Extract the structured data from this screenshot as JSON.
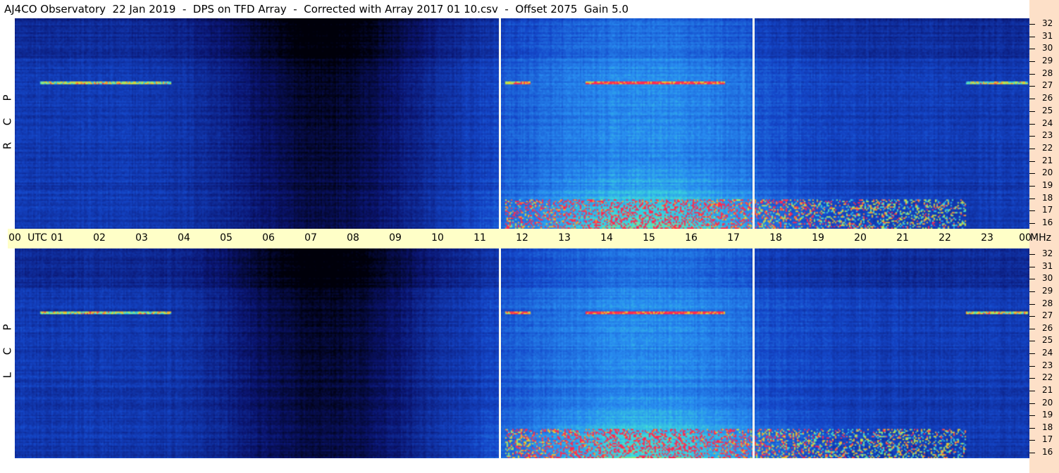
{
  "title": "AJ4CO Observatory  22 Jan 2019  -  DPS on TFD Array  -  Corrected with Array 2017 01 10.csv  -  Offset 2075  Gain 5.0",
  "panels": {
    "rcp": {
      "label": [
        "R",
        "C",
        "P"
      ]
    },
    "lcp": {
      "label": [
        "L",
        "C",
        "P"
      ]
    }
  },
  "chart_data": {
    "type": "heatmap",
    "title": "AJ4CO Observatory  22 Jan 2019  -  DPS on TFD Array  -  Corrected with Array 2017 01 10.csv  -  Offset 2075  Gain 5.0",
    "x_axis": {
      "unit": "UTC",
      "ticks": [
        "00",
        "01",
        "02",
        "03",
        "04",
        "05",
        "06",
        "07",
        "08",
        "09",
        "10",
        "11",
        "12",
        "13",
        "14",
        "15",
        "16",
        "17",
        "18",
        "19",
        "20",
        "21",
        "22",
        "23",
        "00"
      ],
      "range": [
        0,
        24
      ]
    },
    "y_axis": {
      "unit": "MHz",
      "ticks": [
        "16",
        "17",
        "18",
        "19",
        "20",
        "21",
        "22",
        "23",
        "24",
        "25",
        "26",
        "27",
        "28",
        "29",
        "30",
        "31",
        "32"
      ],
      "range": [
        16,
        32
      ]
    },
    "separators_utc": [
      11.45,
      17.45
    ],
    "series": [
      {
        "name": "R C P"
      },
      {
        "name": "L C P"
      }
    ],
    "colors": {
      "background": "#0a2a9a",
      "night": "#000010",
      "day": "#2d86f0",
      "hot": "#ff3030",
      "axis_bg": "#ffffc8",
      "strip_bg": "#fde0c8"
    }
  }
}
